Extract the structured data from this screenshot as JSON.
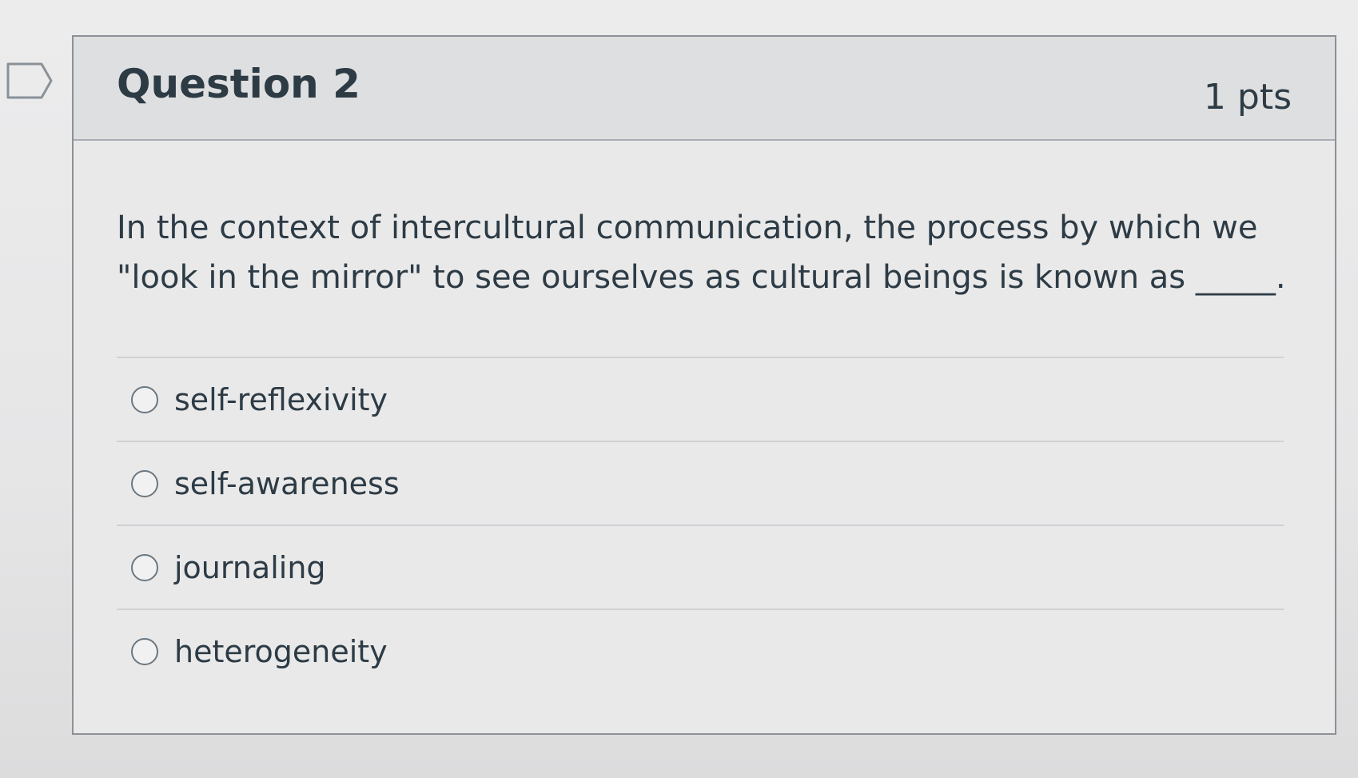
{
  "question": {
    "title": "Question 2",
    "points": "1 pts",
    "text": "In the context of intercultural communication, the process by which we \"look in the mirror\" to see ourselves as cultural beings is known as _____.",
    "flag_icon": "flag-icon"
  },
  "answers": [
    {
      "label": "self-reflexivity",
      "selected": false
    },
    {
      "label": "self-awareness",
      "selected": false
    },
    {
      "label": "journaling",
      "selected": false
    },
    {
      "label": "heterogeneity",
      "selected": false
    }
  ],
  "colors": {
    "text": "#2d3b45",
    "header_bg": "#dedfe0",
    "border": "#8d9196"
  }
}
